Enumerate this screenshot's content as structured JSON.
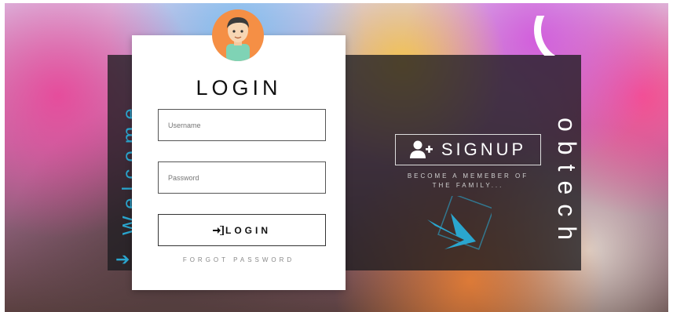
{
  "left_panel": {
    "welcome_text": "Welcome",
    "arrow_glyph": "➔"
  },
  "login_form": {
    "title": "LOGIN",
    "username_placeholder": "Username",
    "password_placeholder": "Password",
    "login_button_label": "LOGIN",
    "login_button_icon": "sign-in-icon",
    "forgot_password_label": "FORGOT PASSWORD"
  },
  "signup_panel": {
    "signup_label": "SIGNUP",
    "signup_icon": "add-user-icon",
    "subtitle_line1": "BECOME A MEMEBER OF",
    "subtitle_line2": "THE FAMILY...",
    "arrow_icon": "arrow-icon"
  },
  "brand": {
    "name": "obtech"
  },
  "colors": {
    "accent": "#2aa6cf",
    "avatar_bg": "#f58f45",
    "panel_dark": "#1e1c20"
  }
}
